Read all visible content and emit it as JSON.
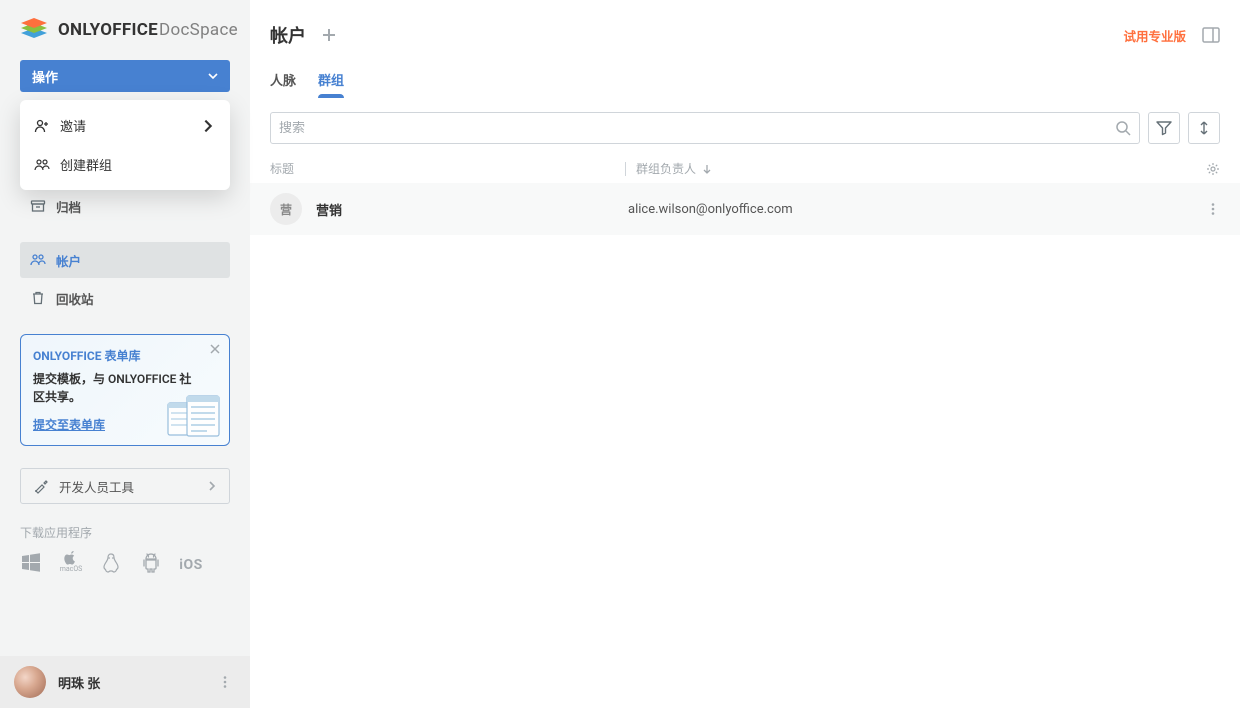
{
  "brand": {
    "name1": "ONLYOFFICE",
    "name2": "DocSpace"
  },
  "sidebar": {
    "actions_label": "操作",
    "dropdown": {
      "invite": "邀请",
      "create_group": "创建群组"
    },
    "nav": {
      "archive": "归档",
      "accounts": "帐户",
      "trash": "回收站"
    },
    "promo": {
      "title": "ONLYOFFICE 表单库",
      "desc": "提交模板，与 ONLYOFFICE 社区共享。",
      "link": "提交至表单库"
    },
    "dev_tools": "开发人员工具",
    "download_label": "下载应用程序",
    "user": "明珠 张"
  },
  "header": {
    "title": "帐户",
    "trial": "试用专业版"
  },
  "tabs": {
    "people": "人脉",
    "groups": "群组"
  },
  "search": {
    "placeholder": "搜索"
  },
  "table": {
    "col_title": "标题",
    "col_manager": "群组负责人",
    "rows": [
      {
        "avatar": "营",
        "title": "营销",
        "manager": "alice.wilson@onlyoffice.com"
      }
    ]
  }
}
